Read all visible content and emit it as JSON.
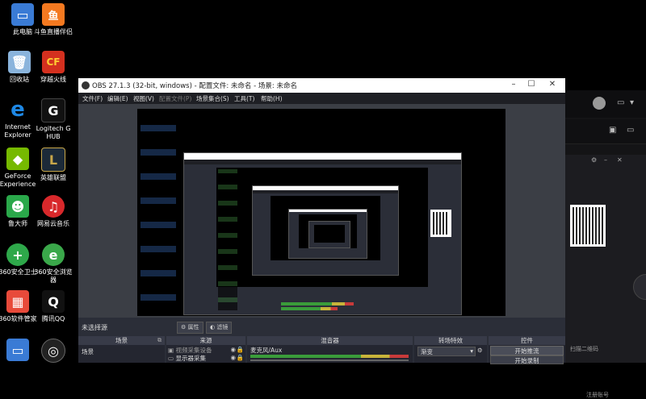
{
  "desktop": {
    "icons": [
      {
        "label": "此电脑",
        "glyph": "▭",
        "color": "#3a7bd5"
      },
      {
        "label": "回收站",
        "glyph": "🗑",
        "color": "#6a9ac8"
      },
      {
        "label": "Internet Explorer",
        "glyph": "e",
        "color": "#1e88e5"
      },
      {
        "label": "GeForce Experience",
        "glyph": "◆",
        "color": "#76b900"
      },
      {
        "label": "鲁大师",
        "glyph": "☻",
        "color": "#2aa84a"
      },
      {
        "label": "360安全卫士",
        "glyph": "+",
        "color": "#2ea84a"
      },
      {
        "label": "360软件管家",
        "glyph": "▦",
        "color": "#e84a3a"
      },
      {
        "label": "斗鱼直播伴侣",
        "glyph": "鱼",
        "color": "#f47920"
      },
      {
        "label": "穿越火线",
        "glyph": "CF",
        "color": "#d4301f"
      },
      {
        "label": "Logitech G HUB",
        "glyph": "G",
        "color": "#111111"
      },
      {
        "label": "英雄联盟",
        "glyph": "L",
        "color": "#c8a74a"
      },
      {
        "label": "网易云音乐",
        "glyph": "♫",
        "color": "#d8282b"
      },
      {
        "label": "360安全浏览器",
        "glyph": "e",
        "color": "#3aa84a"
      },
      {
        "label": "腾讯QQ",
        "glyph": "Q",
        "color": "#ffffff"
      }
    ]
  },
  "obs": {
    "title": "OBS 27.1.3 (32-bit, windows) - 配置文件: 未命名 - 场景: 未命名",
    "menu": [
      "文件(F)",
      "编辑(E)",
      "视图(V)",
      "配置文件(P)",
      "场景集合(S)",
      "工具(T)",
      "帮助(H)"
    ],
    "status_text": "未选择源",
    "properties_label": "属性",
    "filters_label": "滤镜",
    "docks": {
      "scenes": {
        "header": "场景",
        "items": [
          "场景"
        ]
      },
      "sources": {
        "header": "来源",
        "items": [
          "视频采集设备",
          "显示器采集"
        ]
      },
      "mixer": {
        "header": "混音器",
        "track": "麦克风/Aux"
      },
      "transitions": {
        "header": "转场特效",
        "type": "渐变"
      },
      "controls": {
        "header": "控件",
        "buttons": [
          "开始推流",
          "开始录制"
        ]
      }
    }
  },
  "side_app": {
    "qr_caption": "扫描二维码",
    "footer_text": "注册账号"
  },
  "colors": {
    "obs_bg": "#2b2e38",
    "dock_header": "#383b48",
    "titlebar": "#ffffff",
    "desktop": "#000000"
  }
}
